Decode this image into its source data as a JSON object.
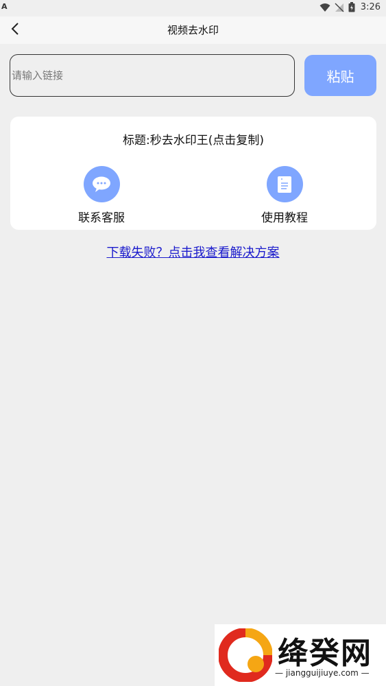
{
  "status_bar": {
    "left_indicator": "A",
    "time": "3:26"
  },
  "nav": {
    "title": "视频去水印"
  },
  "search": {
    "placeholder": "请输入链接",
    "value": ""
  },
  "paste_button": {
    "label": "粘贴"
  },
  "card": {
    "title": "标题:秒去水印王(点击复制)",
    "actions": [
      {
        "label": "联系客服",
        "icon": "chat-bubble-icon"
      },
      {
        "label": "使用教程",
        "icon": "document-icon"
      }
    ]
  },
  "help_link": {
    "text": "下载失败？点击我查看解决方案"
  },
  "watermark": {
    "name": "绛癸网",
    "url": "— jiangguijiuye.com —"
  },
  "colors": {
    "accent": "#7fa6ff",
    "link": "#1a1acc",
    "background": "#efefef",
    "card": "#ffffff"
  }
}
